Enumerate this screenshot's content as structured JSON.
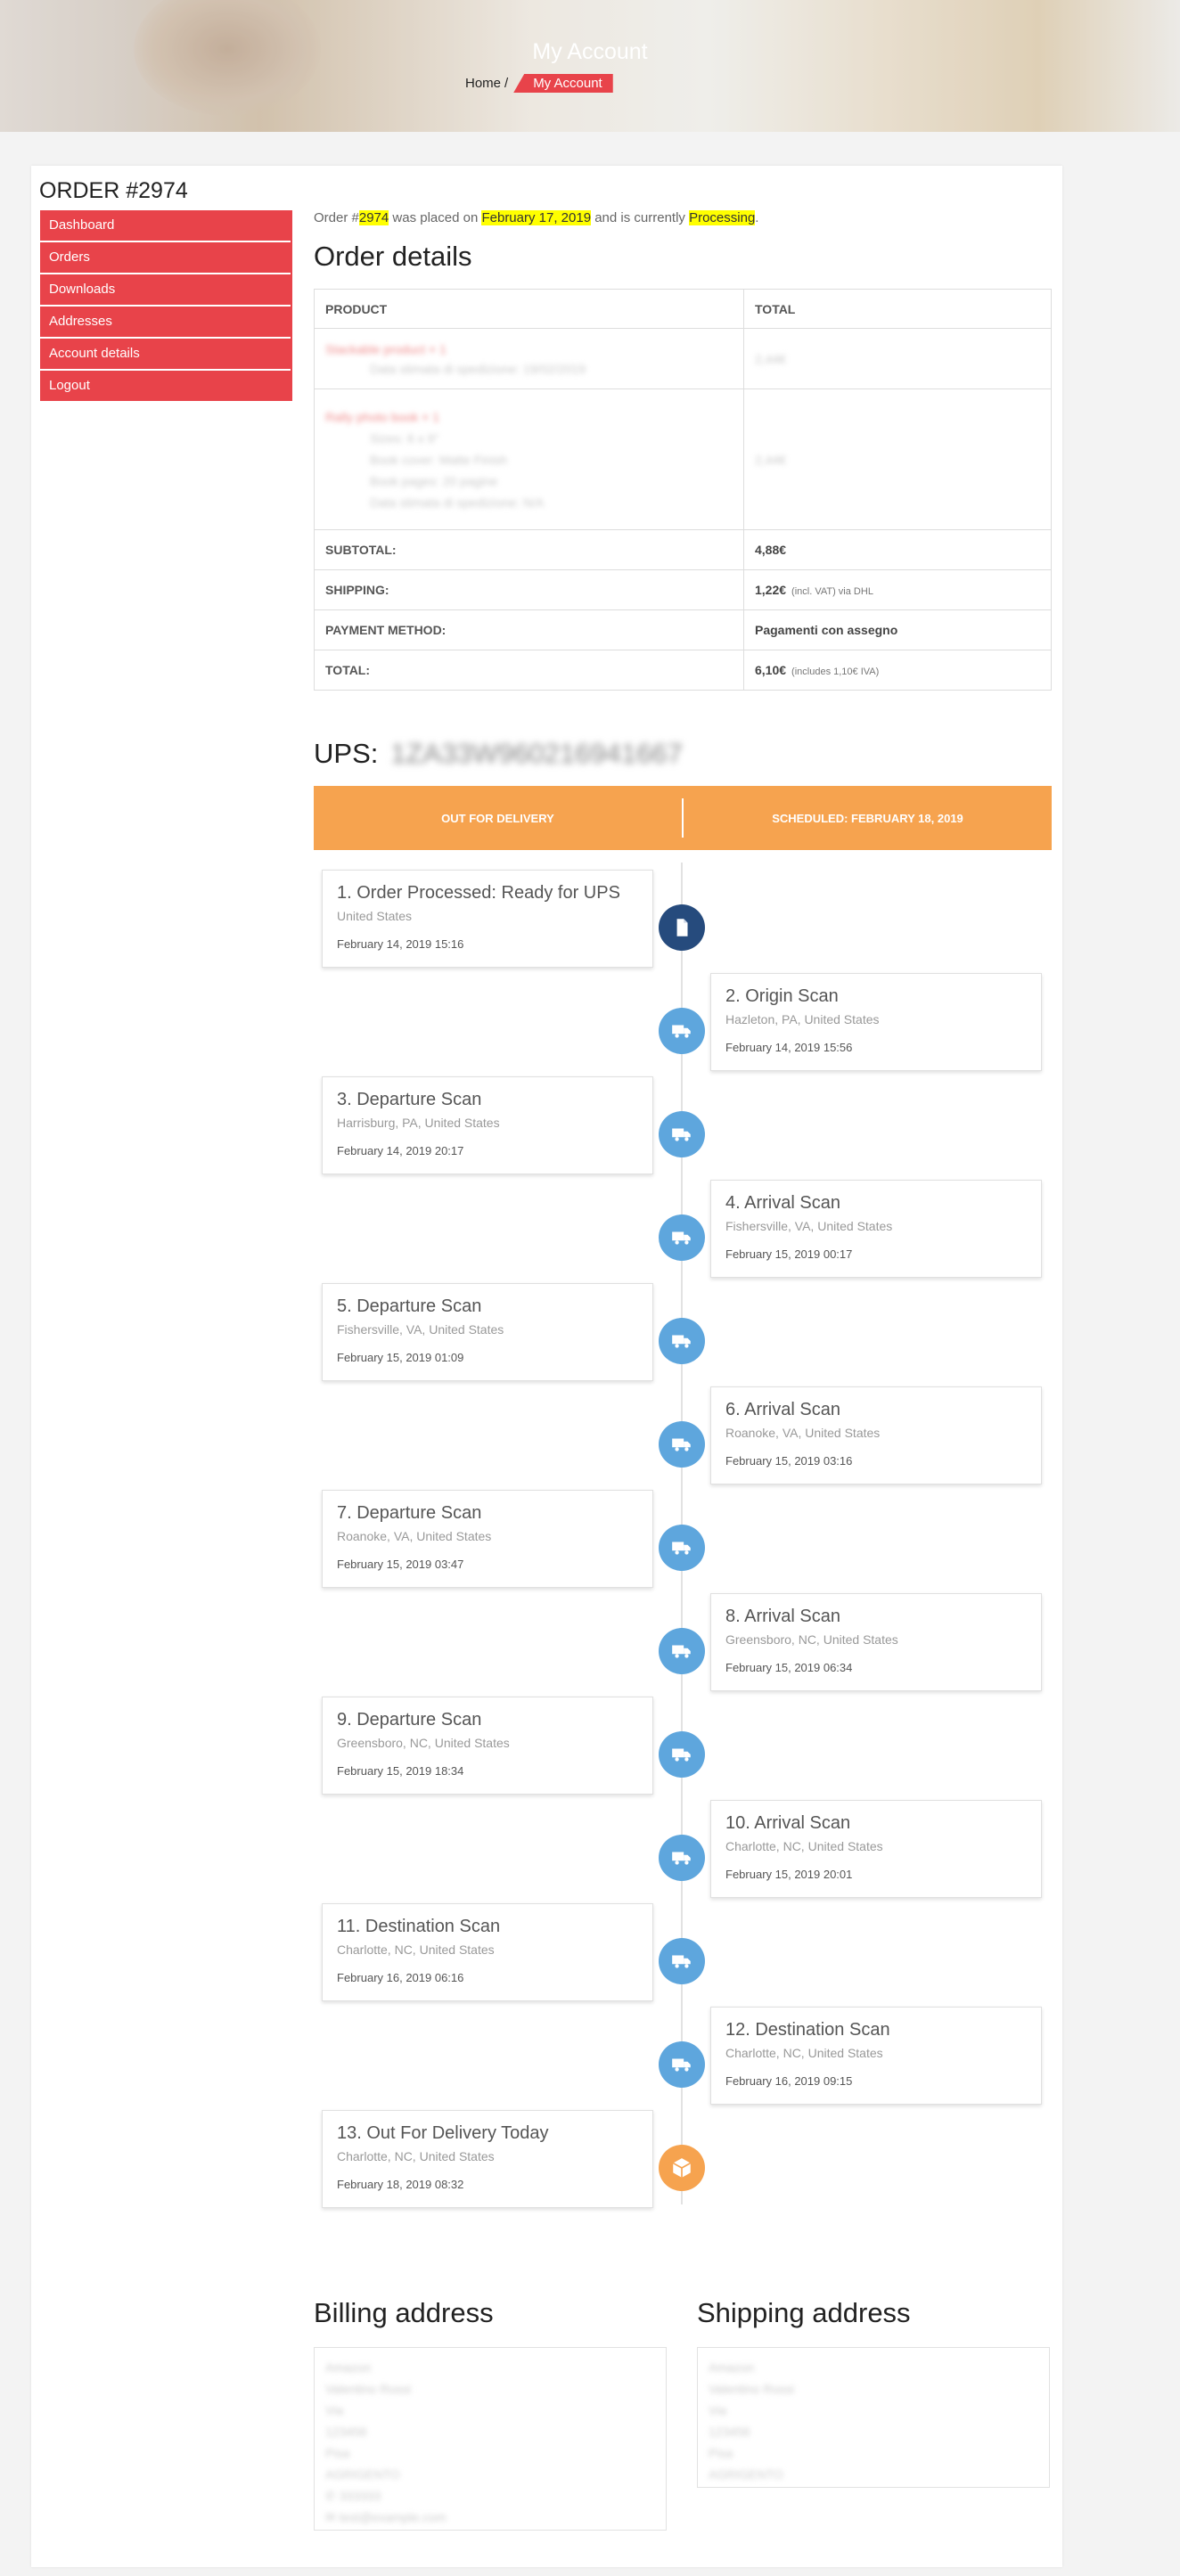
{
  "hero": {
    "title": "My Account",
    "home": "Home",
    "separator": "/",
    "current": "My Account"
  },
  "order": {
    "heading": "ORDER #2974",
    "number": "2974",
    "date": "February 17, 2019",
    "status": "Processing",
    "intro_prefix": "Order #",
    "intro_mid": " was placed on ",
    "intro_mid2": " and is currently ",
    "intro_end": "."
  },
  "nav": {
    "items": [
      "Dashboard",
      "Orders",
      "Downloads",
      "Addresses",
      "Account details",
      "Logout"
    ]
  },
  "order_details": {
    "title": "Order details",
    "col_product": "PRODUCT",
    "col_total": "TOTAL",
    "products": [
      {
        "name": "Stackable product × 1",
        "meta": [
          "Data stimata di spedizione: 19/02/2019"
        ],
        "total": "2,44€"
      },
      {
        "name": "Rally photo book × 1",
        "meta": [
          "Sizes: 6 x 9\"",
          "Book cover: Matte Finish",
          "Book pages: 20 pagine",
          "Data stimata di spedizione: N/A"
        ],
        "total": "2,44€"
      }
    ],
    "subtotal_label": "SUBTOTAL:",
    "subtotal": "4,88€",
    "shipping_label": "SHIPPING:",
    "shipping": "1,22€",
    "shipping_note": "(incl. VAT) via DHL",
    "payment_label": "PAYMENT METHOD:",
    "payment": "Pagamenti con assegno",
    "total_label": "TOTAL:",
    "total": "6,10€",
    "total_note": "(includes 1,10€  IVA)"
  },
  "tracking": {
    "carrier": "UPS:",
    "number": "1ZA33W960216941667",
    "status_left": "OUT FOR DELIVERY",
    "status_right": "SCHEDULED: FEBRUARY 18, 2019",
    "events": [
      {
        "title": "1. Order Processed: Ready for UPS",
        "location": "United States",
        "date": "February 14, 2019 15:16",
        "icon": "document-icon"
      },
      {
        "title": "2. Origin Scan",
        "location": "Hazleton, PA, United States",
        "date": "February 14, 2019 15:56",
        "icon": "truck-icon"
      },
      {
        "title": "3. Departure Scan",
        "location": "Harrisburg, PA, United States",
        "date": "February 14, 2019 20:17",
        "icon": "truck-icon"
      },
      {
        "title": "4. Arrival Scan",
        "location": "Fishersville, VA, United States",
        "date": "February 15, 2019 00:17",
        "icon": "truck-icon"
      },
      {
        "title": "5. Departure Scan",
        "location": "Fishersville, VA, United States",
        "date": "February 15, 2019 01:09",
        "icon": "truck-icon"
      },
      {
        "title": "6. Arrival Scan",
        "location": "Roanoke, VA, United States",
        "date": "February 15, 2019 03:16",
        "icon": "truck-icon"
      },
      {
        "title": "7. Departure Scan",
        "location": "Roanoke, VA, United States",
        "date": "February 15, 2019 03:47",
        "icon": "truck-icon"
      },
      {
        "title": "8. Arrival Scan",
        "location": "Greensboro, NC, United States",
        "date": "February 15, 2019 06:34",
        "icon": "truck-icon"
      },
      {
        "title": "9. Departure Scan",
        "location": "Greensboro, NC, United States",
        "date": "February 15, 2019 18:34",
        "icon": "truck-icon"
      },
      {
        "title": "10. Arrival Scan",
        "location": "Charlotte, NC, United States",
        "date": "February 15, 2019 20:01",
        "icon": "truck-icon"
      },
      {
        "title": "11. Destination Scan",
        "location": "Charlotte, NC, United States",
        "date": "February 16, 2019 06:16",
        "icon": "truck-icon"
      },
      {
        "title": "12. Destination Scan",
        "location": "Charlotte, NC, United States",
        "date": "February 16, 2019 09:15",
        "icon": "truck-icon"
      },
      {
        "title": "13. Out For Delivery Today",
        "location": "Charlotte, NC, United States",
        "date": "February 18, 2019 08:32",
        "icon": "package-icon"
      }
    ]
  },
  "billing": {
    "title": "Billing address",
    "lines": [
      "Amazon",
      "Valentino Rossi",
      "Via",
      "123456",
      "Pisa",
      "AGRIGENTO",
      "333333",
      "test@example.com"
    ]
  },
  "shipping_address": {
    "title": "Shipping address",
    "lines": [
      "Amazon",
      "Valentino Rossi",
      "Via",
      "123456",
      "Pisa",
      "AGRIGENTO"
    ]
  },
  "colors": {
    "accent": "#e8434a",
    "orange": "#f6a34f",
    "blue": "#5ea6dd",
    "navy": "#264b7d"
  }
}
